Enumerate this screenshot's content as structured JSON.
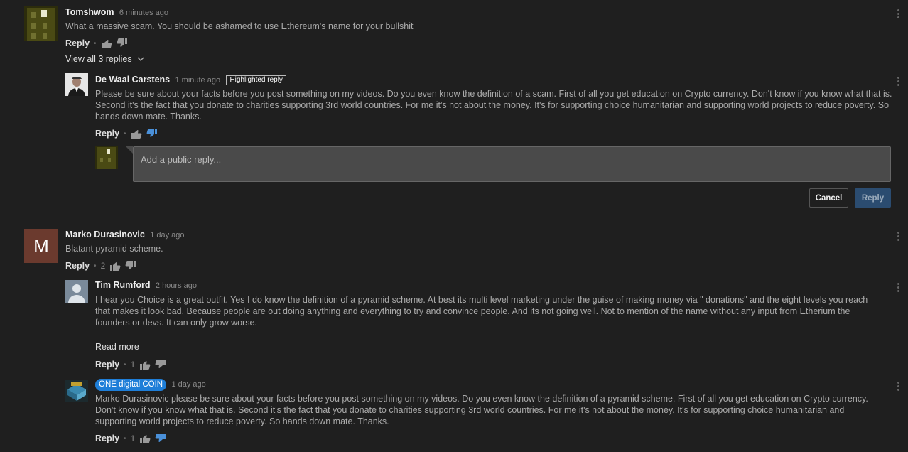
{
  "actions": {
    "reply_label": "Reply",
    "cancel_label": "Cancel",
    "submit_reply_label": "Reply",
    "reply_placeholder": "Add a public reply...",
    "read_more_label": "Read more"
  },
  "colors": {
    "background": "#1f1f1f",
    "accent_blue": "#1e7ed8",
    "disliked_blue": "#4a90d9",
    "avatar_m_bg": "#6b3a2e"
  },
  "comments": [
    {
      "author": "Tomshwom",
      "time": "6 minutes ago",
      "text": "What a massive scam.  You should be ashamed to use Ethereum's name for your bullshit",
      "likes": "",
      "view_replies": "View all 3 replies",
      "replies": [
        {
          "author": "De Waal Carstens",
          "time": "1 minute ago",
          "badge": "Highlighted reply",
          "text": "Please be sure about your facts before you post something on my videos. Do you even know the definition of a scam. First of all you get education on Crypto currency. Don't know if you know what that is. Second it's the fact that you donate to charities supporting 3rd world countries. For me it's not about the money. It's for supporting choice humanitarian and supporting world projects to reduce poverty. So hands down mate. Thanks.",
          "likes": "",
          "disliked": true
        }
      ]
    },
    {
      "author": "Marko Durasinovic",
      "avatar_letter": "M",
      "time": "1 day ago",
      "text": "Blatant pyramid scheme.",
      "likes": "2",
      "replies": [
        {
          "author": "Tim Rumford",
          "time": "2 hours ago",
          "text": "I hear you Choice is a great outfit. Yes I do know the definition of a pyramid scheme. At best its multi level marketing under the guise of making money via \" donations\" and the eight levels you reach that makes it look bad. Because people are out doing anything and everything to try and convince people. And its not going well.  Not to mention of the name without any input from Etherium the founders or devs. It can only grow worse.",
          "likes": "1"
        },
        {
          "author": "ONE digital COIN",
          "time": "1 day ago",
          "text": "Marko Durasinovic please be sure about your facts before you post something on my videos. Do you even know the definition of a pyramid scheme. First of all you get education on Crypto currency. Don't know if you know what that is. Second it's the fact that you donate to charities supporting 3rd world countries. For me it's not about the money. It's for supporting choice humanitarian and supporting world projects to reduce poverty. So hands down mate. Thanks.",
          "likes": "1",
          "disliked": true
        }
      ]
    }
  ]
}
